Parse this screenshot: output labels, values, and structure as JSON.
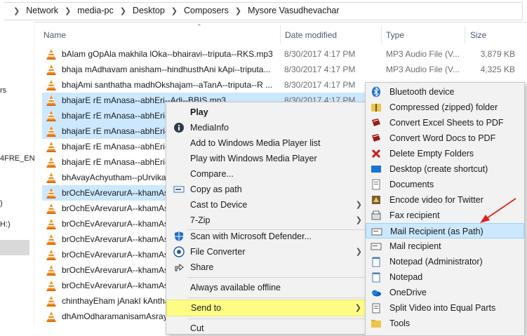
{
  "breadcrumb": [
    "Network",
    "media-pc",
    "Desktop",
    "Composers",
    "Mysore Vasudhevachar"
  ],
  "columns": {
    "name": "Name",
    "date": "Date modified",
    "type": "Type",
    "size": "Size"
  },
  "leftnav_fragments": [
    "rs",
    "4FRE_EN",
    ")",
    "H:)"
  ],
  "rows": [
    {
      "name": "bAlam gOpAla makhila lOka--bhairavi--triputa--RKS.mp3",
      "date": "8/30/2017 4:17 PM",
      "type": "MP3 Audio File (V...",
      "size": "3,879 KB",
      "selected": false
    },
    {
      "name": "bhaja mAdhavam anisham--hindhusthAni kApi--triputa...",
      "date": "8/30/2017 4:17 PM",
      "type": "MP3 Audio File (V...",
      "size": "4,325 KB",
      "selected": false
    },
    {
      "name": "bhajAmi santhatha madhOkshajam--aTanA--triputa--R ...",
      "date": "8/30/2017 4:17 PM",
      "type": "",
      "size": "",
      "selected": false
    },
    {
      "name": "bhajarE rE mAnasa--abhEri--Adi--BBIS.mp3",
      "date": "8/30/2017 4:17 PM",
      "type": "",
      "size": "",
      "selected": true
    },
    {
      "name": "bhajarE rE mAnasa--abhEri--",
      "date": "",
      "type": "",
      "size": "",
      "selected": true
    },
    {
      "name": "bhajarE rE mAnasa--abhEri--",
      "date": "",
      "type": "",
      "size": "",
      "selected": true
    },
    {
      "name": "bhajarE rE mAnasa--abhEri--",
      "date": "",
      "type": "",
      "size": "",
      "selected": false
    },
    {
      "name": "bhajarE rE mAnasa--abhEri--",
      "date": "",
      "type": "",
      "size": "",
      "selected": false
    },
    {
      "name": "bhAvayAchyutham--pUrvika",
      "date": "",
      "type": "",
      "size": "",
      "selected": false
    },
    {
      "name": "brOchEvArevarurA--khamAs",
      "date": "",
      "type": "",
      "size": "",
      "selected": true
    },
    {
      "name": "brOchEvArevarurA--khamAs",
      "date": "",
      "type": "",
      "size": "",
      "selected": false
    },
    {
      "name": "brOchEvArevarurA--khamAs",
      "date": "",
      "type": "",
      "size": "",
      "selected": false
    },
    {
      "name": "brOchEvArevarurA--khamAs",
      "date": "",
      "type": "",
      "size": "",
      "selected": false
    },
    {
      "name": "brOchEvArevarurA--khamAs",
      "date": "",
      "type": "",
      "size": "",
      "selected": false
    },
    {
      "name": "brOchEvArevarurA--khamAs",
      "date": "",
      "type": "",
      "size": "",
      "selected": false
    },
    {
      "name": "brOchEvArevarurA--khamAs",
      "date": "",
      "type": "",
      "size": "",
      "selected": false
    },
    {
      "name": "chinthayEham jAnakI kAntha",
      "date": "",
      "type": "",
      "size": "",
      "selected": false
    },
    {
      "name": "dhAmOdharamanisamAsrayI",
      "date": "",
      "type": "",
      "size": "",
      "selected": false
    }
  ],
  "context_menu": {
    "play": "Play",
    "mediainfo": "MediaInfo",
    "add_wmp": "Add to Windows Media Player list",
    "play_wmp": "Play with Windows Media Player",
    "compare": "Compare...",
    "copy_path": "Copy as path",
    "cast": "Cast to Device",
    "zip": "7-Zip",
    "defender": "Scan with Microsoft Defender...",
    "converter": "File Converter",
    "share": "Share",
    "offline": "Always available offline",
    "send_to": "Send to",
    "cut_partial": "Cut"
  },
  "sendto_menu": [
    "Bluetooth device",
    "Compressed (zipped) folder",
    "Convert Excel Sheets to PDF",
    "Convert Word Docs to PDF",
    "Delete Empty Folders",
    "Desktop (create shortcut)",
    "Documents",
    "Encode video for Twitter",
    "Fax recipient",
    "Mail Recipient (as Path)",
    "Mail recipient",
    "Notepad (Administrator)",
    "Notepad",
    "OneDrive",
    "Split Video into Equal Parts",
    "Tools"
  ],
  "colors": {
    "selection": "#cce8ff",
    "sendto_highlight": "#fdfd86",
    "annotation_arrow": "#e02020"
  }
}
